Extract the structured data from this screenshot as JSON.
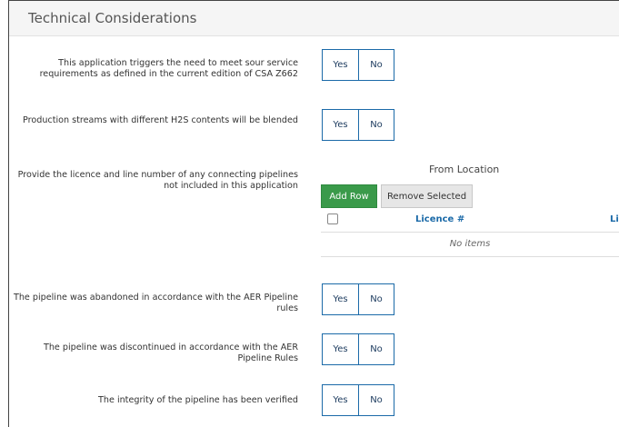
{
  "section": {
    "title": "Technical Considerations"
  },
  "questions": [
    {
      "text": "This application triggers the need to meet sour service requirements as defined in the current edition of CSA Z662",
      "yes": "Yes",
      "no": "No"
    },
    {
      "text": "Production streams with different H2S contents will be blended",
      "yes": "Yes",
      "no": "No"
    },
    {
      "text": "Provide the licence and line number of any connecting pipelines not included in this application"
    },
    {
      "text": "The pipeline was abandoned in accordance with the AER Pipeline rules",
      "yes": "Yes",
      "no": "No"
    },
    {
      "text": "The pipeline was discontinued in accordance with the AER Pipeline Rules",
      "yes": "Yes",
      "no": "No"
    },
    {
      "text": "The integrity of the pipeline has been verified",
      "yes": "Yes",
      "no": "No"
    }
  ],
  "connecting_pipelines": {
    "group_label": "From Location",
    "add_row": "Add Row",
    "remove_selected": "Remove Selected",
    "columns": [
      "Licence #",
      "Lir"
    ],
    "empty_text": "No items"
  }
}
